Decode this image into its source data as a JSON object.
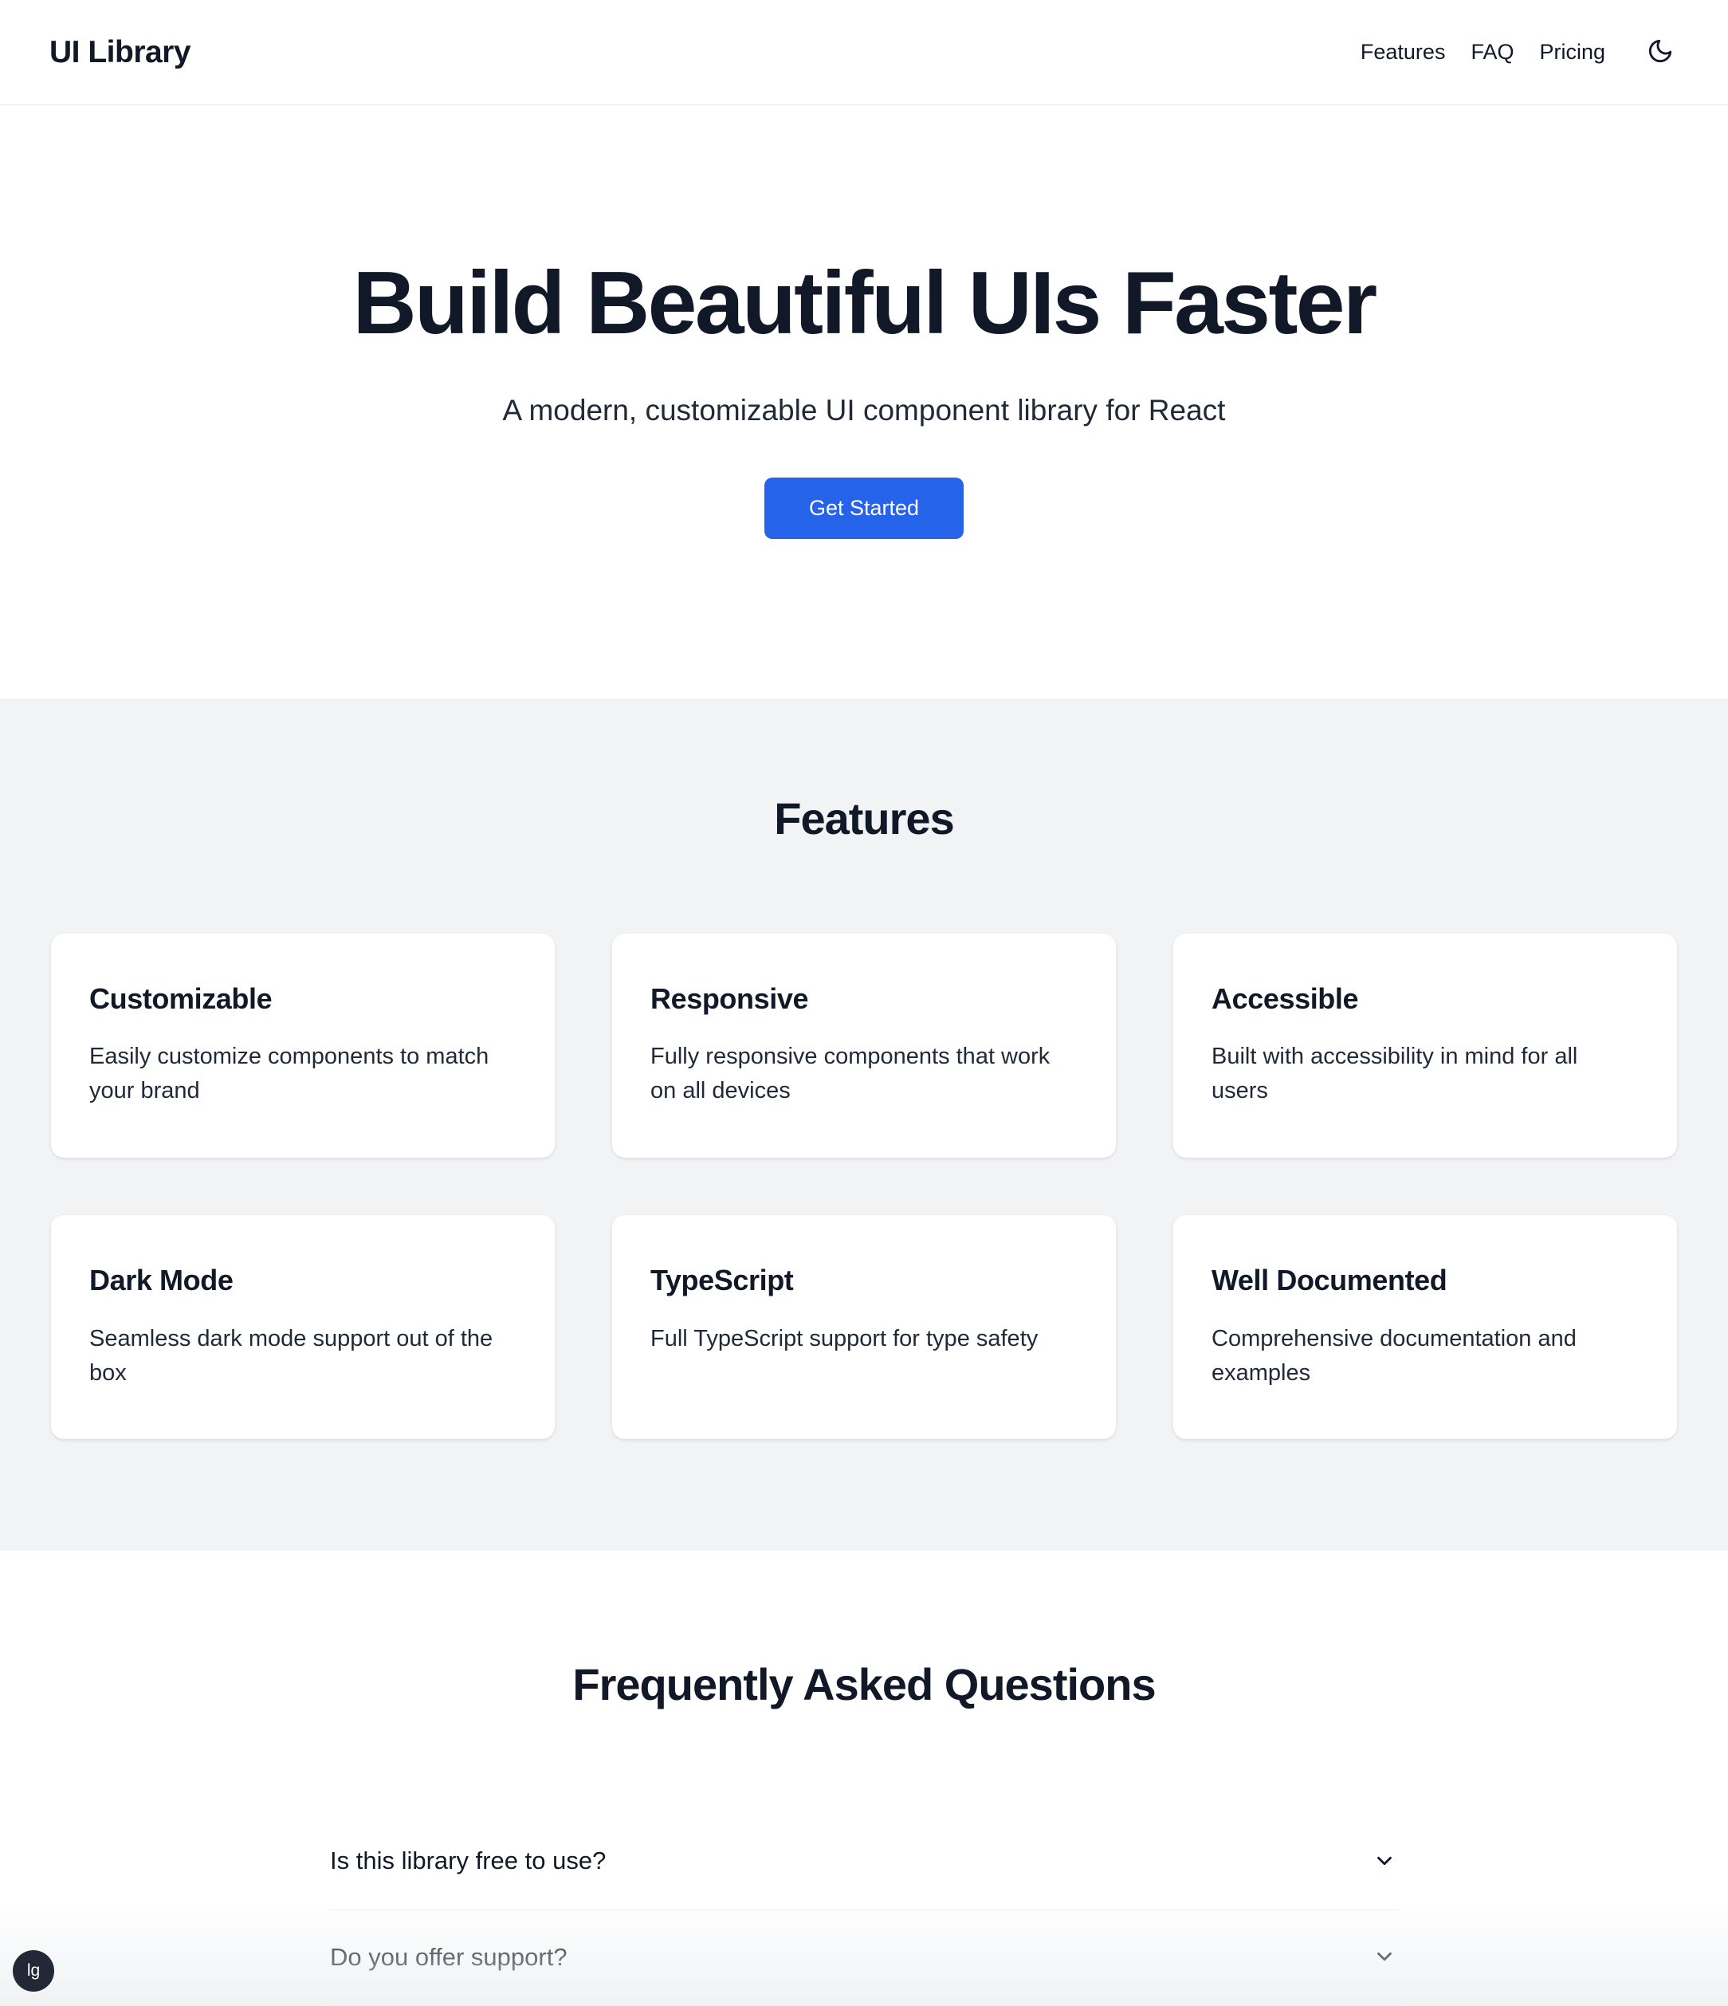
{
  "header": {
    "brand": "UI Library",
    "nav": [
      {
        "label": "Features"
      },
      {
        "label": "FAQ"
      },
      {
        "label": "Pricing"
      }
    ],
    "theme_toggle_icon": "moon-icon"
  },
  "hero": {
    "title": "Build Beautiful UIs Faster",
    "subtitle": "A modern, customizable UI component library for React",
    "cta_label": "Get Started"
  },
  "features": {
    "title": "Features",
    "cards": [
      {
        "title": "Customizable",
        "desc": "Easily customize components to match your brand"
      },
      {
        "title": "Responsive",
        "desc": "Fully responsive components that work on all devices"
      },
      {
        "title": "Accessible",
        "desc": "Built with accessibility in mind for all users"
      },
      {
        "title": "Dark Mode",
        "desc": "Seamless dark mode support out of the box"
      },
      {
        "title": "TypeScript",
        "desc": "Full TypeScript support for type safety"
      },
      {
        "title": "Well Documented",
        "desc": "Comprehensive documentation and examples"
      }
    ]
  },
  "faq": {
    "title": "Frequently Asked Questions",
    "items": [
      {
        "question": "Is this library free to use?",
        "chevron_icon": "chevron-down-icon"
      },
      {
        "question": "Do you offer support?",
        "chevron_icon": "chevron-down-icon"
      }
    ]
  },
  "badge": {
    "label": "lg"
  },
  "colors": {
    "accent": "#2563eb",
    "text_primary": "#111827",
    "section_bg": "#f1f3f5",
    "page_bg": "#ffffff",
    "divider": "#e8eaee",
    "badge_bg": "#232836"
  }
}
